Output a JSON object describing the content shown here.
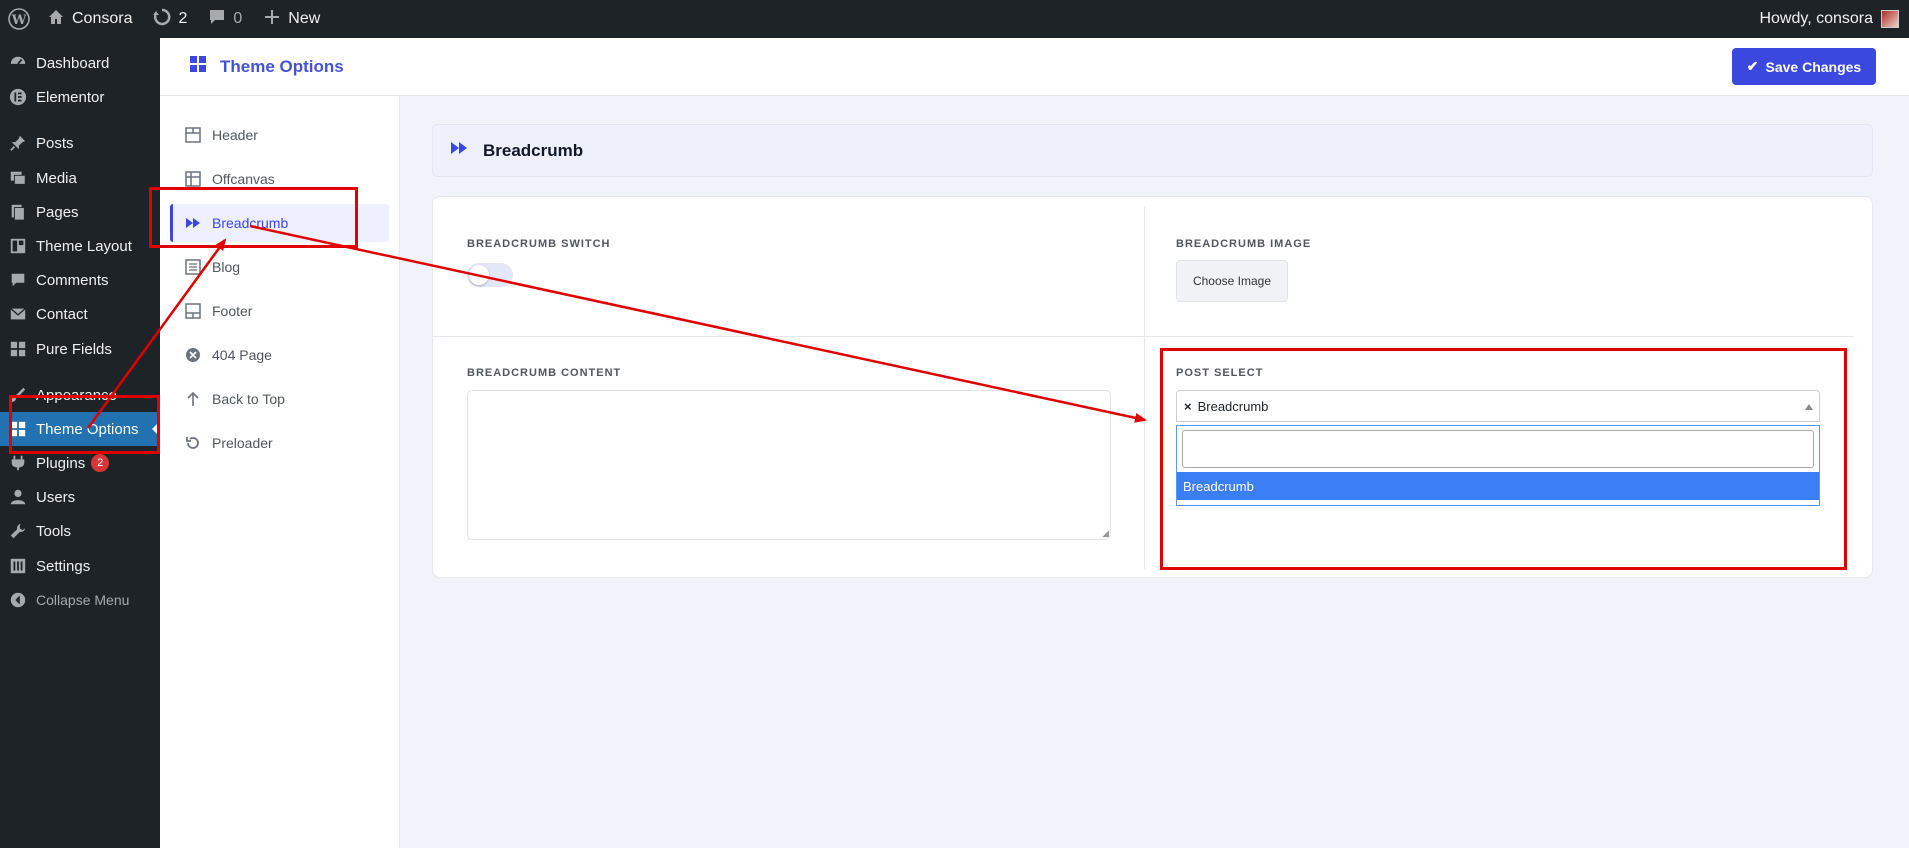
{
  "adminbar": {
    "site_name": "Consora",
    "updates_count": "2",
    "comments_count": "0",
    "new_label": "New",
    "howdy": "Howdy, consora"
  },
  "sidebar": {
    "items": [
      {
        "label": "Dashboard",
        "icon": "dashboard-icon"
      },
      {
        "label": "Elementor",
        "icon": "elementor-icon"
      },
      {
        "label": "Posts",
        "icon": "pin-icon"
      },
      {
        "label": "Media",
        "icon": "media-icon"
      },
      {
        "label": "Pages",
        "icon": "pages-icon"
      },
      {
        "label": "Theme Layout",
        "icon": "layout-icon"
      },
      {
        "label": "Comments",
        "icon": "comment-icon"
      },
      {
        "label": "Contact",
        "icon": "mail-icon"
      },
      {
        "label": "Pure Fields",
        "icon": "grid-icon"
      },
      {
        "label": "Appearance",
        "icon": "brush-icon"
      },
      {
        "label": "Theme Options",
        "icon": "grid-icon"
      },
      {
        "label": "Plugins",
        "icon": "plugin-icon",
        "badge": "2"
      },
      {
        "label": "Users",
        "icon": "user-icon"
      },
      {
        "label": "Tools",
        "icon": "wrench-icon"
      },
      {
        "label": "Settings",
        "icon": "settings-icon"
      },
      {
        "label": "Collapse Menu",
        "icon": "collapse-icon"
      }
    ]
  },
  "header": {
    "title": "Theme Options",
    "save_label": "Save Changes"
  },
  "options_nav": {
    "items": [
      {
        "label": "Header"
      },
      {
        "label": "Offcanvas"
      },
      {
        "label": "Breadcrumb"
      },
      {
        "label": "Blog"
      },
      {
        "label": "Footer"
      },
      {
        "label": "404 Page"
      },
      {
        "label": "Back to Top"
      },
      {
        "label": "Preloader"
      }
    ]
  },
  "section": {
    "title": "Breadcrumb",
    "switch_label": "BREADCRUMB SWITCH",
    "image_label": "BREADCRUMB IMAGE",
    "choose_image_label": "Choose Image",
    "content_label": "BREADCRUMB CONTENT",
    "post_select_label": "POST SELECT",
    "post_select_value": "Breadcrumb",
    "dropdown_option": "Breadcrumb"
  },
  "colors": {
    "accent": "#3b48e0",
    "wp_dark": "#1d2327",
    "wp_blue": "#2271b1",
    "annotation_red": "#e00000"
  }
}
